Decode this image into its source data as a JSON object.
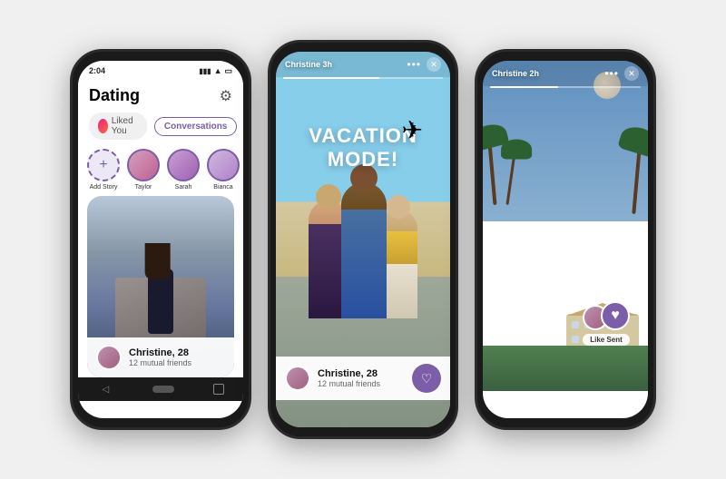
{
  "phones": {
    "phone1": {
      "statusBar": {
        "time": "2:04",
        "batteryIcon": "▮"
      },
      "header": {
        "title": "Dating",
        "gearIcon": "⚙"
      },
      "tabs": {
        "likedYou": "Liked You",
        "conversations": "Conversations"
      },
      "stories": [
        {
          "label": "Add Story",
          "type": "add"
        },
        {
          "label": "Taylor",
          "type": "avatar"
        },
        {
          "label": "Sarah",
          "type": "avatar"
        },
        {
          "label": "Bianca",
          "type": "avatar"
        }
      ],
      "profileCard": {
        "name": "Christine, 28",
        "mutual": "12 mutual friends"
      },
      "nav": {
        "back": "◁",
        "home": "⬤",
        "square": ""
      }
    },
    "phone2": {
      "statusBar": {
        "name": "Christine 3h"
      },
      "storyText": "VACATION MODE!",
      "airplaneEmoji": "✈",
      "profileCard": {
        "name": "Christine, 28",
        "mutual": "12 mutual friends"
      },
      "likeIcon": "♡",
      "dots": "•••",
      "close": "✕",
      "nav": {
        "back": "◁",
        "home": "⬤",
        "square": ""
      }
    },
    "phone3": {
      "statusBar": {
        "name": "Christine 2h"
      },
      "likeSentLabel": "Like Sent",
      "dots": "•••",
      "close": "✕",
      "likeIcon": "♥",
      "nav": {
        "back": "◁",
        "home": "⬤",
        "square": ""
      }
    }
  }
}
